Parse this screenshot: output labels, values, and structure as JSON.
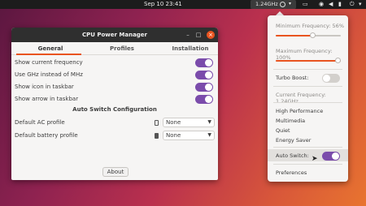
{
  "topbar": {
    "clock": "Sep 10  23:41",
    "cpu_freq": "1.24GHz",
    "icons": [
      "chevron-down-icon",
      "network-icon",
      "volume-icon",
      "battery-icon",
      "power-icon"
    ]
  },
  "window": {
    "title": "CPU Power Manager",
    "tabs": [
      "General",
      "Profiles",
      "Installation"
    ],
    "active_tab": "General",
    "options": [
      {
        "label": "Show current frequency",
        "enabled": true
      },
      {
        "label": "Use GHz instead of MHz",
        "enabled": true
      },
      {
        "label": "Show icon in taskbar",
        "enabled": true
      },
      {
        "label": "Show arrow in taskbar",
        "enabled": true
      }
    ],
    "section_title": "Auto Switch Configuration",
    "ac_profile_label": "Default AC profile",
    "ac_profile_value": "None",
    "battery_profile_label": "Default battery profile",
    "battery_profile_value": "None",
    "about_label": "About"
  },
  "menu": {
    "min_freq_label": "Minimum Frequency: 56%",
    "min_freq_value": 0.56,
    "max_freq_label": "Maximum Frequency: 100%",
    "max_freq_value": 1.0,
    "turbo_label": "Turbo Boost:",
    "turbo_enabled": false,
    "current_freq_label": "Current Frequency: 1.24GHz",
    "profiles": [
      "High Performance",
      "Multimedia",
      "Quiet",
      "Energy Saver"
    ],
    "auto_switch_label": "Auto Switch:",
    "auto_switch_enabled": true,
    "preferences_label": "Preferences"
  },
  "colors": {
    "accent": "#e95420",
    "toggle_on": "#7b4cab",
    "panel_bg": "#f6f5f4",
    "titlebar": "#2f2f2f"
  }
}
